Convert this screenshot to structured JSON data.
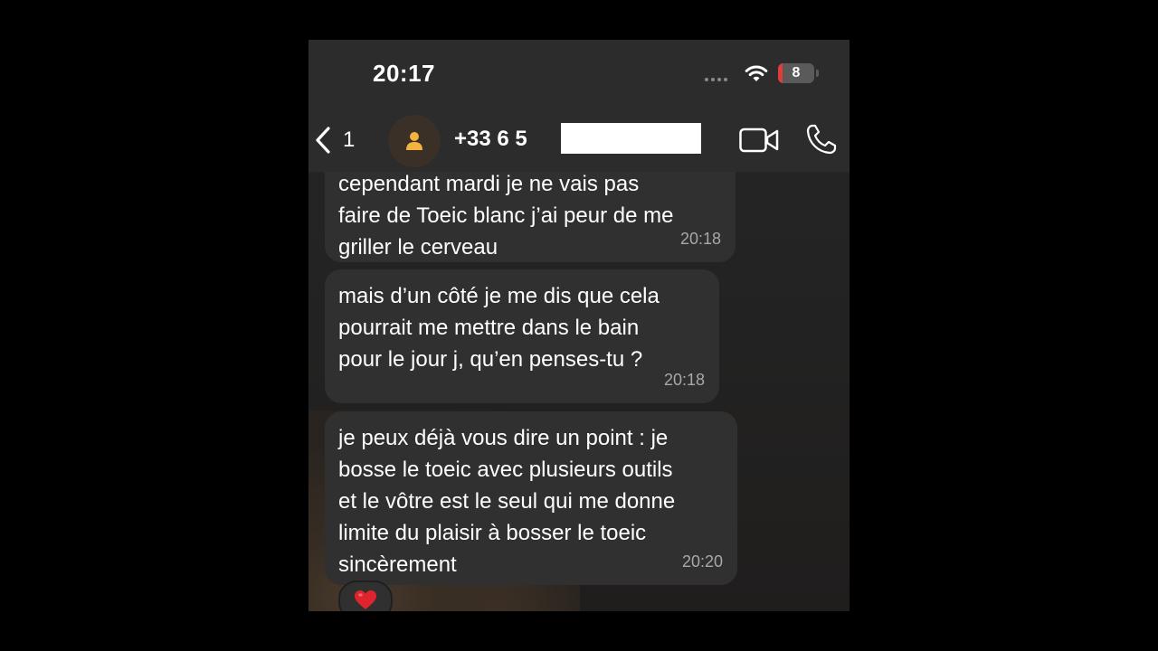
{
  "status_bar": {
    "time": "20:17",
    "battery_level": "8",
    "colors": {
      "battery_low": "#e23b3b"
    }
  },
  "header": {
    "back_count": "1",
    "contact_name": "+33 6 5",
    "icons": [
      "chevron-left-icon",
      "person-icon",
      "video-camera-icon",
      "phone-icon"
    ]
  },
  "messages": [
    {
      "text": "cependant mardi je ne vais pas\nfaire de Toeic blanc j’ai peur de me\ngriller le cerveau",
      "time": "20:18"
    },
    {
      "text": "mais d’un côté je me dis que cela\npourrait me mettre dans le bain\npour le jour j, qu’en penses-tu ?",
      "time": "20:18"
    },
    {
      "text": "je peux déjà vous dire un point : je\nbosse le toeic avec plusieurs outils\net le vôtre est le seul qui me donne\nlimite du plaisir à bosser le toeic\nsincèrement",
      "time": "20:20"
    }
  ],
  "reaction": {
    "emoji": "heart-icon",
    "color": "#e0242e"
  }
}
